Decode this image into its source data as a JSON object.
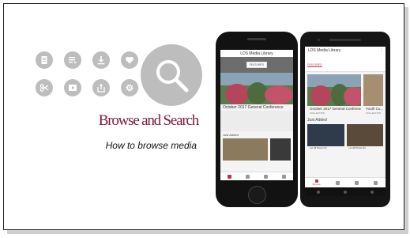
{
  "slide": {
    "title": "Browse and Search",
    "subtitle": "How to browse media"
  },
  "icons": [
    {
      "name": "document-icon"
    },
    {
      "name": "playlist-icon"
    },
    {
      "name": "download-icon"
    },
    {
      "name": "heart-icon"
    },
    {
      "name": "scissors-icon"
    },
    {
      "name": "video-icon"
    },
    {
      "name": "share-icon"
    },
    {
      "name": "settings-icon"
    },
    {
      "name": "search-icon"
    }
  ],
  "iphone": {
    "app_title": "LDS Media Library",
    "featured_chip": "FEATURED",
    "hero_caption": "October 2017 General Conference",
    "section_label": "Just Added"
  },
  "android": {
    "app_title": "LDS Media Library",
    "featured_chip": "FEATURED",
    "card1_title": "October 2017 General Conference",
    "card1_label": "COLLECTION",
    "card2_title": "Youth Cu... Lessons",
    "card2_label": "COLLECTION",
    "section_label": "Just Added",
    "item1_label": "Let All Press On",
    "item2_label": "Let All Press On",
    "tab_label": "Browse"
  },
  "colors": {
    "accent": "#7a1b3a",
    "icon_bg": "#bdbdbd",
    "tab_active": "#b53a4e"
  }
}
